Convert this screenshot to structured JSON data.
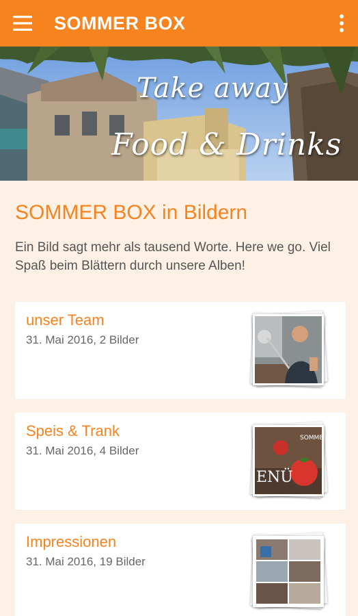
{
  "appbar": {
    "title": "SOMMER BOX",
    "color": "#f7831f"
  },
  "hero": {
    "line1": "Take away",
    "line2": "Food & Drinks"
  },
  "section": {
    "title": "SOMMER BOX in Bildern",
    "intro": "Ein Bild sagt mehr als tausend Worte. Here we go. Viel Spaß beim Blättern durch unsere Alben!"
  },
  "albums": [
    {
      "title": "unser Team",
      "meta": "31. Mai 2016, 2 Bilder"
    },
    {
      "title": "Speis & Trank",
      "meta": "31. Mai 2016, 4 Bilder",
      "thumb_text_top": "SOMMER",
      "thumb_text_bottom": "ENÜ"
    },
    {
      "title": "Impressionen",
      "meta": "31. Mai 2016, 19 Bilder"
    }
  ],
  "colors": {
    "accent": "#f7831f",
    "background": "#fdf1e6",
    "card": "#ffffff",
    "text": "#555555"
  },
  "icons": {
    "menu": "hamburger-menu-icon",
    "overflow": "more-vert-icon"
  }
}
